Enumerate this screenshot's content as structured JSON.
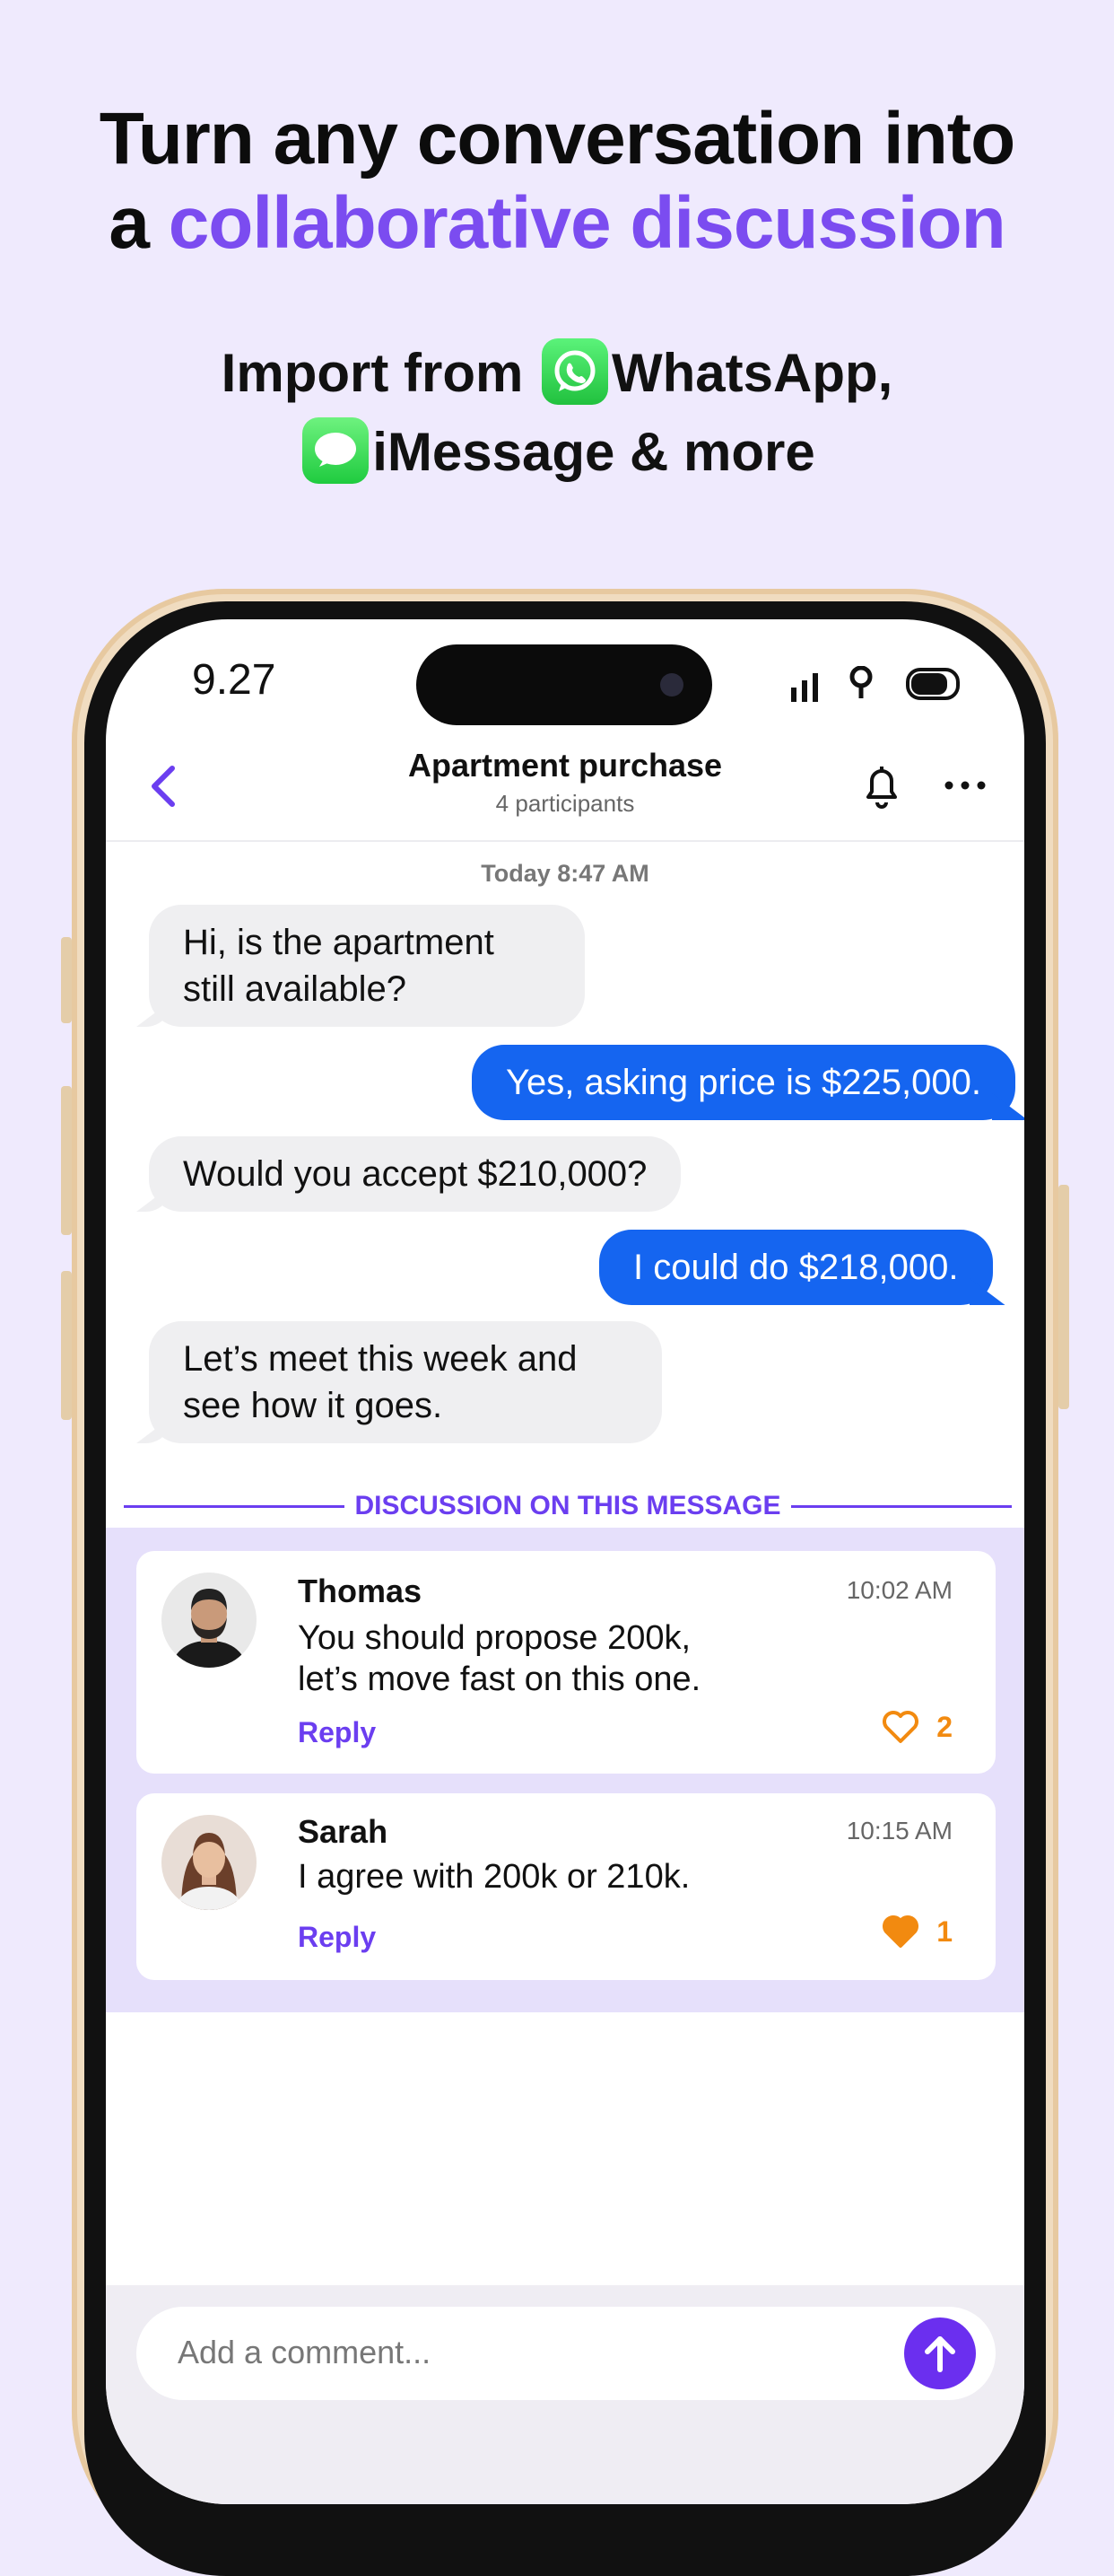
{
  "headline": {
    "line1": "Turn any conversation into",
    "line2_prefix": "a ",
    "line2_accent": "collaborative discussion"
  },
  "subline": {
    "part1": "Import from ",
    "app1": "WhatsApp,",
    "app2": "iMessage & more"
  },
  "status_bar": {
    "time": "9.27"
  },
  "chat": {
    "title": "Apartment purchase",
    "subtitle": "4 participants",
    "date_separator": "Today 8:47 AM",
    "messages": [
      {
        "direction": "incoming",
        "text_line1": "Hi, is the apartment",
        "text_line2": "still available?"
      },
      {
        "direction": "outgoing",
        "text": "Yes, asking price is $225,000."
      },
      {
        "direction": "incoming",
        "text": "Would you accept $210,000?"
      },
      {
        "direction": "outgoing",
        "text": "I could do $218,000."
      },
      {
        "direction": "incoming",
        "text_line1": "Let’s meet this week and",
        "text_line2": "see how it goes."
      }
    ]
  },
  "discussion": {
    "label": "DISCUSSION ON THIS MESSAGE",
    "comments": [
      {
        "name": "Thomas",
        "time": "10:02 AM",
        "text_line1": "You should propose 200k,",
        "text_line2": "let’s move fast on this one.",
        "reply": "Reply",
        "likes": "2",
        "liked": false
      },
      {
        "name": "Sarah",
        "time": "10:15 AM",
        "text_line1": "I agree with 200k or 210k.",
        "reply": "Reply",
        "likes": "1",
        "liked": true
      }
    ]
  },
  "composer": {
    "placeholder": "Add a comment..."
  },
  "colors": {
    "accent": "#6b3ef0",
    "outgoing_bubble": "#1565f0",
    "like": "#f28a10",
    "background": "#efeafd"
  }
}
